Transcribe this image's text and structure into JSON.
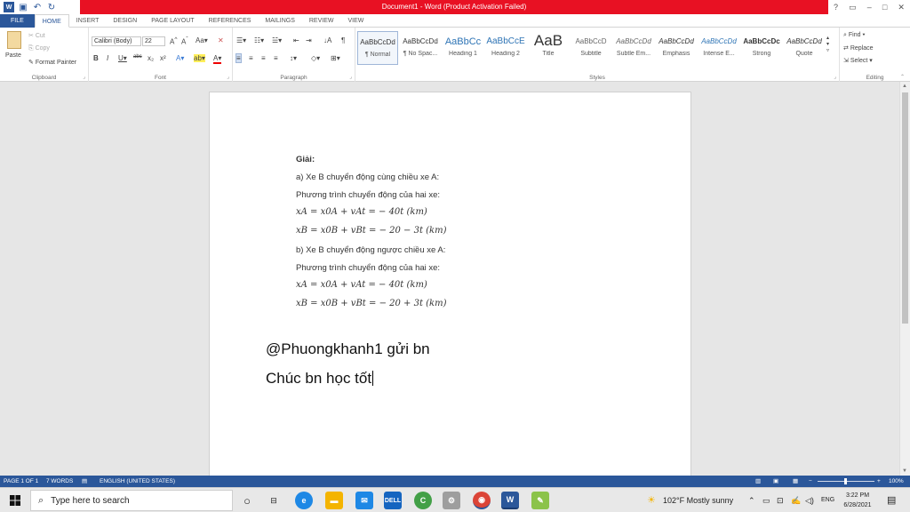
{
  "window": {
    "title": "Document1 - Word (Product Activation Failed)",
    "help": "?",
    "controls": [
      "–",
      "□",
      "✕"
    ]
  },
  "tabs": [
    "FILE",
    "HOME",
    "INSERT",
    "DESIGN",
    "PAGE LAYOUT",
    "REFERENCES",
    "MAILINGS",
    "REVIEW",
    "VIEW"
  ],
  "ribbon": {
    "clipboard": {
      "paste": "Paste",
      "cut": "Cut",
      "copy": "Copy",
      "format_painter": "Format Painter",
      "label": "Clipboard"
    },
    "font": {
      "name": "Calibri (Body)",
      "size": "22",
      "label": "Font"
    },
    "paragraph": {
      "label": "Paragraph"
    },
    "styles": {
      "label": "Styles",
      "items": [
        {
          "preview": "AaBbCcDd",
          "name": "¶ Normal"
        },
        {
          "preview": "AaBbCcDd",
          "name": "¶ No Spac..."
        },
        {
          "preview": "AaBbCc",
          "name": "Heading 1"
        },
        {
          "preview": "AaBbCcE",
          "name": "Heading 2"
        },
        {
          "preview": "AaB",
          "name": "Title"
        },
        {
          "preview": "AaBbCcD",
          "name": "Subtitle"
        },
        {
          "preview": "AaBbCcDd",
          "name": "Subtle Em..."
        },
        {
          "preview": "AaBbCcDd",
          "name": "Emphasis"
        },
        {
          "preview": "AaBbCcDd",
          "name": "Intense E..."
        },
        {
          "preview": "AaBbCcDc",
          "name": "Strong"
        },
        {
          "preview": "AaBbCcDd",
          "name": "Quote"
        }
      ]
    },
    "editing": {
      "find": "Find",
      "replace": "Replace",
      "select": "Select",
      "label": "Editing"
    }
  },
  "document": {
    "heading": "Giải:",
    "line_a": "a) Xe B chuyển động cùng chiều xe A:",
    "line_eqs": "Phương trình chuyển động của hai xe:",
    "eq1": "xA = x0A + vAt = − 40t (km)",
    "eq2": "xB = x0B + vBt = − 20 − 3t (km)",
    "line_b": "b) Xe B chuyển động ngược chiều xe A:",
    "line_eqs2": "Phương trình chuyển động của hai xe:",
    "eq3": "xA = x0A + vAt = − 40t (km)",
    "eq4": "xB = x0B + vBt = − 20 + 3t (km)",
    "sig1": "@Phuongkhanh1 gửi bn",
    "sig2": "Chúc bn học tốt"
  },
  "status": {
    "page": "PAGE 1 OF 1",
    "words": "7 WORDS",
    "language": "ENGLISH (UNITED STATES)",
    "zoom": "100%"
  },
  "taskbar": {
    "search_placeholder": "Type here to search",
    "weather": "102°F  Mostly sunny",
    "lang": "ENG",
    "time": "3:22 PM",
    "date": "6/28/2021"
  }
}
